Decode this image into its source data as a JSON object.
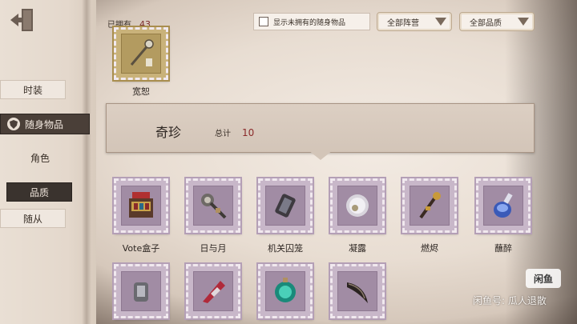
{
  "header": {
    "owned_label": "已拥有",
    "owned_count": "43",
    "show_unowned_label": "显示未拥有的随身物品",
    "faction_filter": "全部阵营",
    "quality_filter": "全部品质"
  },
  "sidebar": {
    "items": [
      {
        "label": "时装"
      },
      {
        "label": "随身物品"
      },
      {
        "label": "角色"
      },
      {
        "label": "品质"
      },
      {
        "label": "随从"
      }
    ]
  },
  "top_item": {
    "label": "宽恕"
  },
  "section": {
    "title": "奇珍",
    "total_label": "总计",
    "total_count": "10"
  },
  "items": [
    {
      "label": "Vote盒子",
      "icon": "vote-box-icon"
    },
    {
      "label": "日与月",
      "icon": "sun-moon-scepter-icon"
    },
    {
      "label": "机关囚笼",
      "icon": "mechanism-cage-icon"
    },
    {
      "label": "凝露",
      "icon": "dew-orb-icon"
    },
    {
      "label": "燃烬",
      "icon": "ember-staff-icon"
    },
    {
      "label": "蘸醉",
      "icon": "potion-bottle-icon"
    },
    {
      "label": "",
      "icon": "lantern-icon"
    },
    {
      "label": "",
      "icon": "crystal-blade-icon"
    },
    {
      "label": "",
      "icon": "green-gem-icon"
    },
    {
      "label": "",
      "icon": "horn-icon"
    }
  ],
  "watermark": {
    "logo": "闲鱼",
    "text": "闲鱼号: 瓜人退散"
  },
  "colors": {
    "accent_dark": "#4a3f38",
    "count_red": "#7a2a2a",
    "stamp_purple": "#c8b7c9",
    "stamp_gold": "#c9b27a"
  }
}
